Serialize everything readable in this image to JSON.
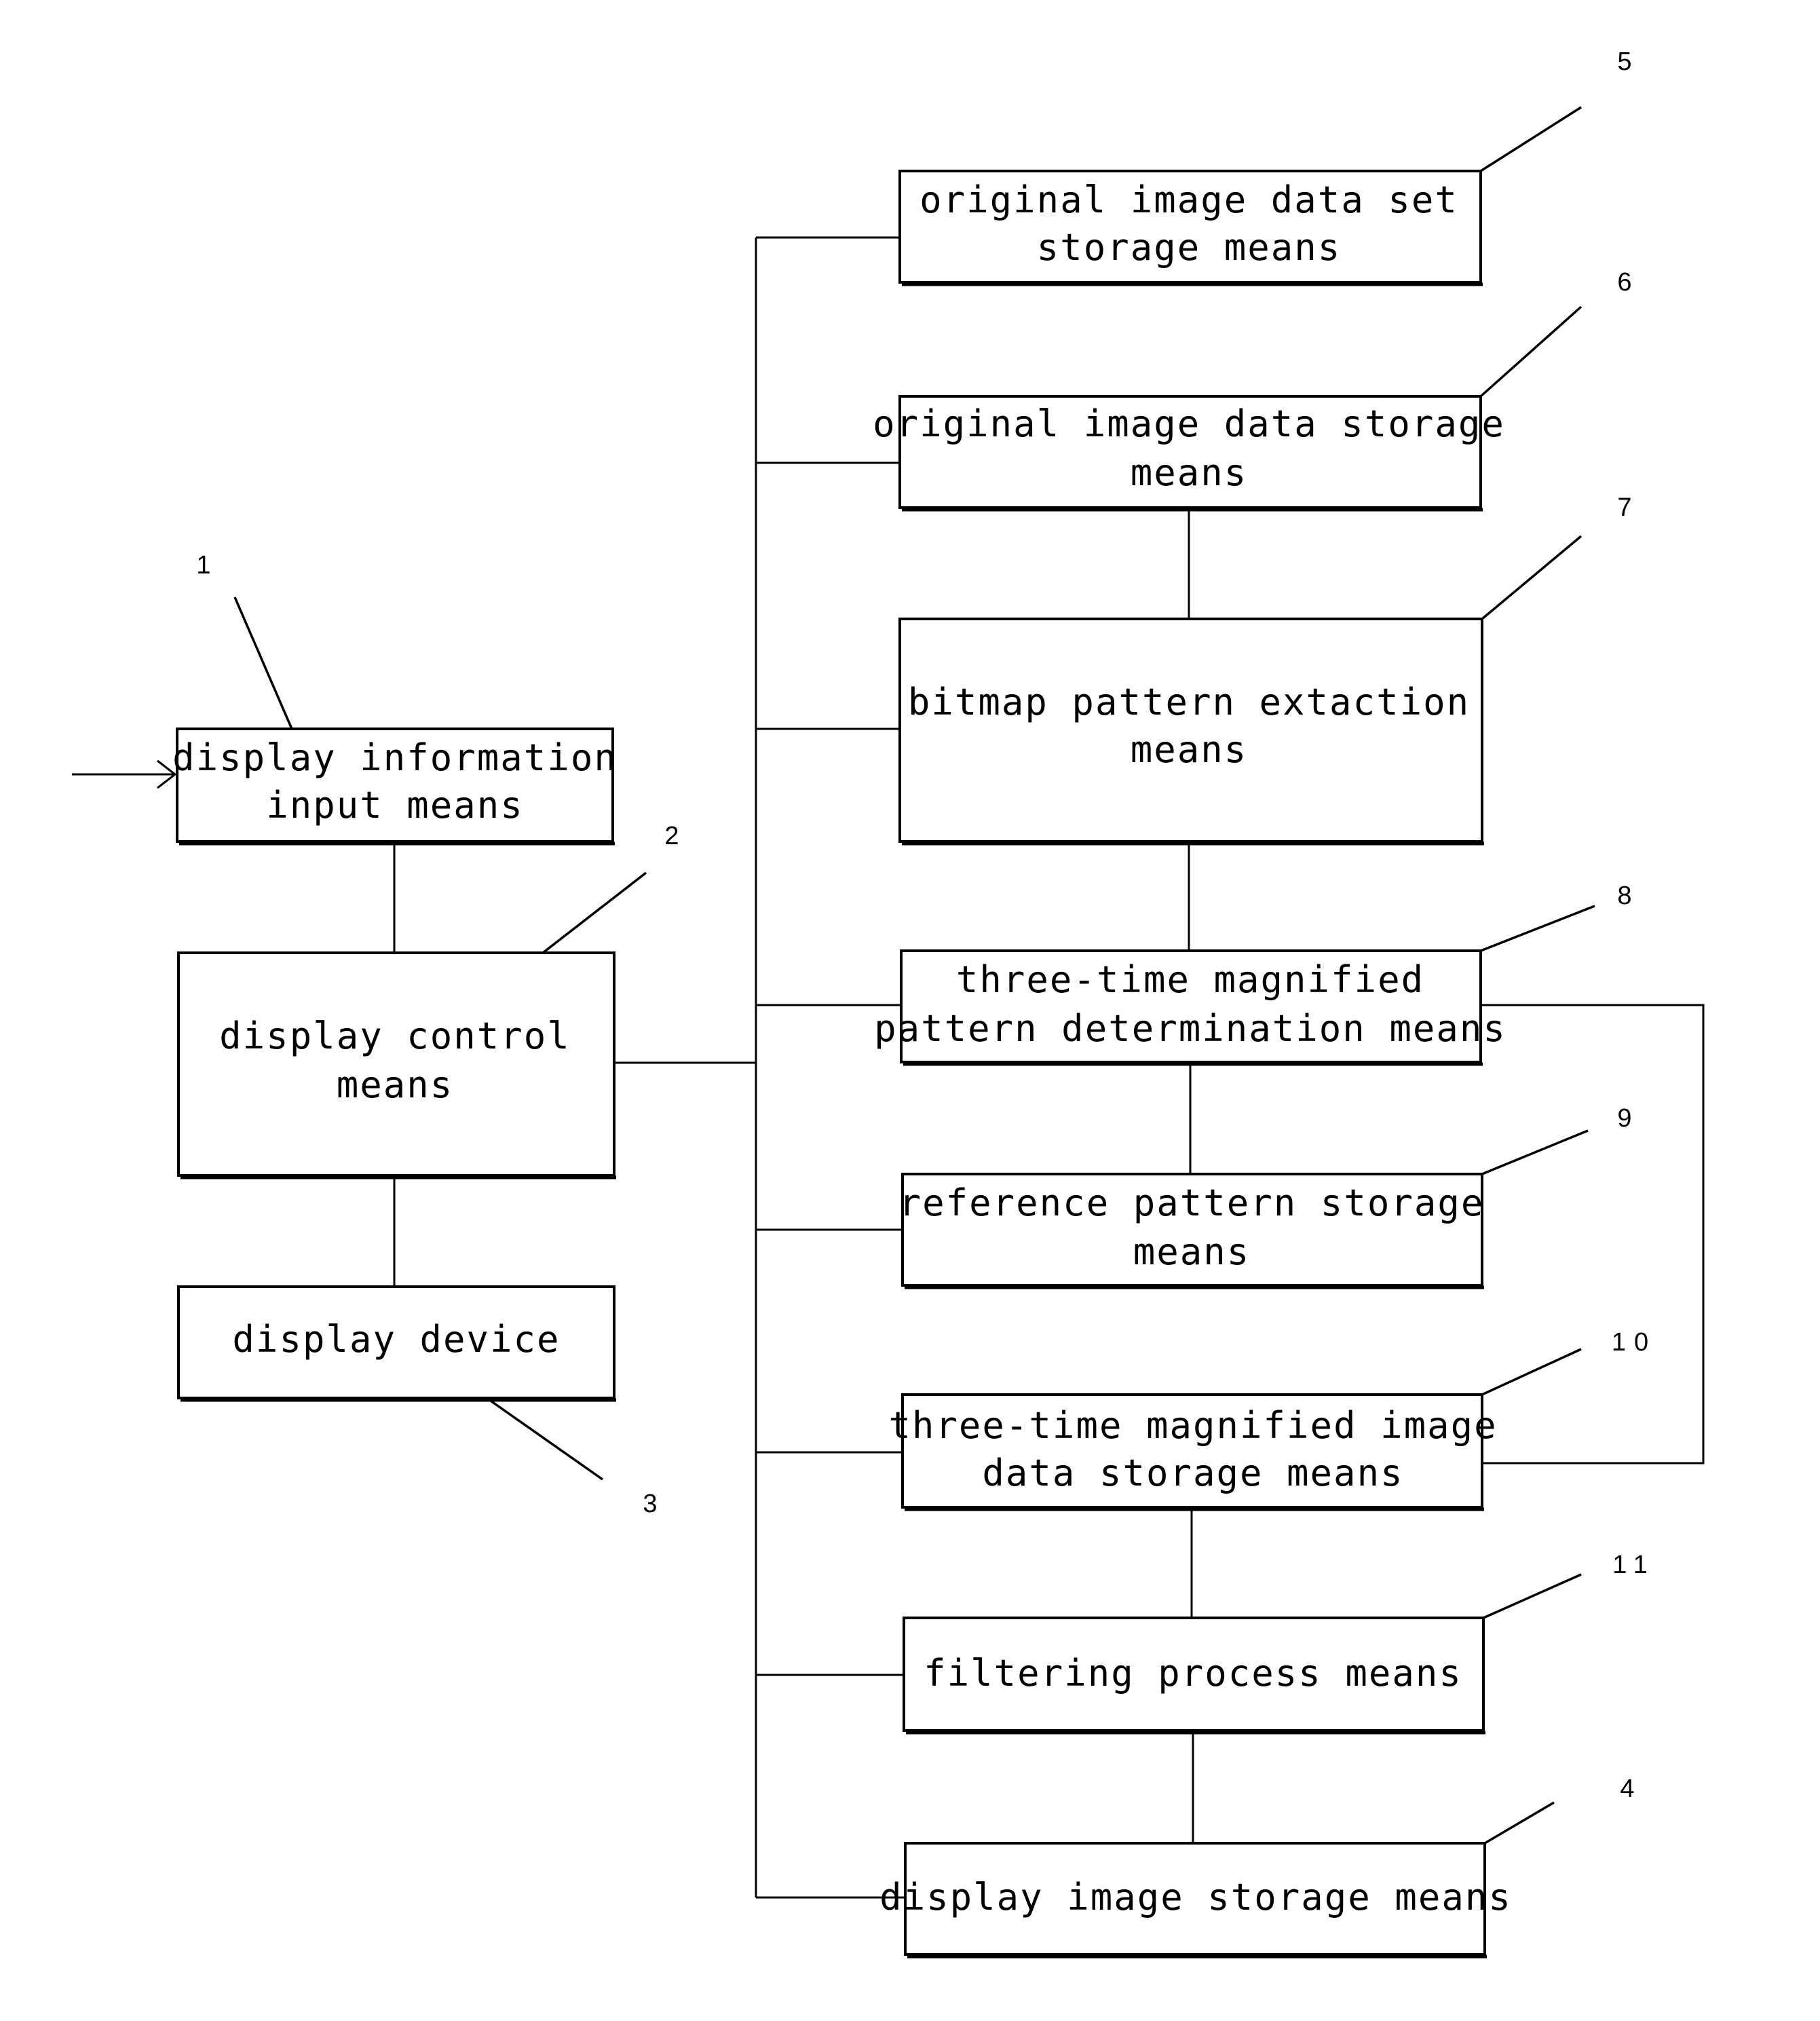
{
  "figure": {
    "blocks": [
      {
        "ref": "1",
        "lines": [
          "display information",
          "input means"
        ]
      },
      {
        "ref": "2",
        "lines": [
          "display control",
          "means"
        ]
      },
      {
        "ref": "3",
        "lines": [
          "display device"
        ]
      },
      {
        "ref": "5",
        "lines": [
          "original image data set",
          "storage means"
        ]
      },
      {
        "ref": "6",
        "lines": [
          "original image data storage",
          "means"
        ]
      },
      {
        "ref": "7",
        "lines": [
          "bitmap pattern extaction",
          "means"
        ]
      },
      {
        "ref": "8",
        "lines": [
          "three-time magnified",
          "pattern determination means"
        ]
      },
      {
        "ref": "9",
        "lines": [
          "reference pattern storage",
          "means"
        ]
      },
      {
        "ref": "10",
        "lines": [
          "three-time magnified image",
          "data storage means"
        ]
      },
      {
        "ref": "11",
        "lines": [
          "filtering process means"
        ]
      },
      {
        "ref": "4",
        "lines": [
          "display image storage means"
        ]
      }
    ],
    "ref_labels": {
      "r1": "1",
      "r2": "2",
      "r3": "3",
      "r4": "4",
      "r5": "5",
      "r6": "6",
      "r7": "7",
      "r8": "8",
      "r9": "9",
      "r10": "10",
      "r11": "11"
    }
  }
}
